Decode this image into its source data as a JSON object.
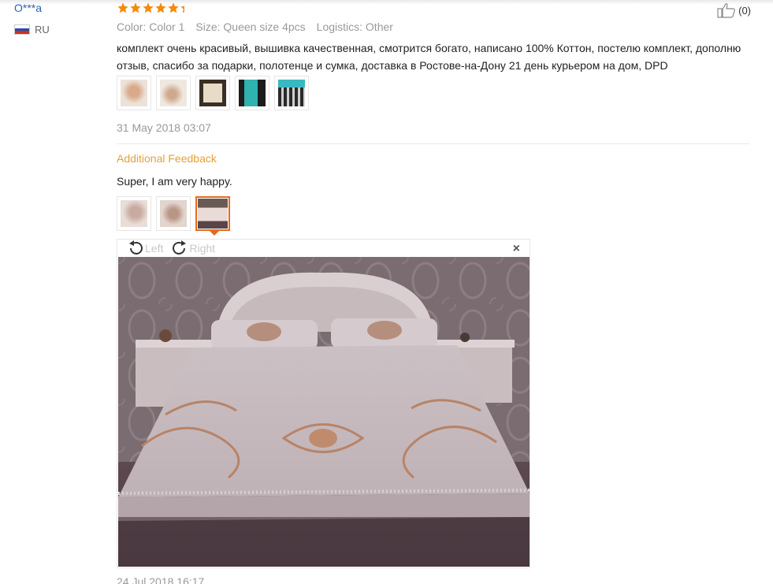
{
  "review": {
    "user_name": "O***a",
    "country": "RU",
    "rating_stars": 5,
    "likes": "(0)",
    "meta": {
      "color": "Color: Color 1",
      "size": "Size: Queen size 4pcs",
      "logistics": "Logistics: Other"
    },
    "text": "комплект очень красивый, вышивка качественная, смотрится богато, написано 100% Коттон, постелю комплект, дополню отзыв, спасибо за подарки, полотенце и сумка, доставка в Ростове-на-Дону 21 день курьером на дом, DPD",
    "date": "31 May 2018 03:07"
  },
  "additional": {
    "heading": "Additional Feedback",
    "text": "Super, I am very happy.",
    "date": "24 Jul 2018 16:17"
  },
  "viewer": {
    "left_label": "Left",
    "right_label": "Right",
    "close_label": "×"
  },
  "colors": {
    "accent": "#e56b1f",
    "star": "#f48b0a",
    "user_link": "#2764b0",
    "additional_heading": "#e4a13a"
  }
}
